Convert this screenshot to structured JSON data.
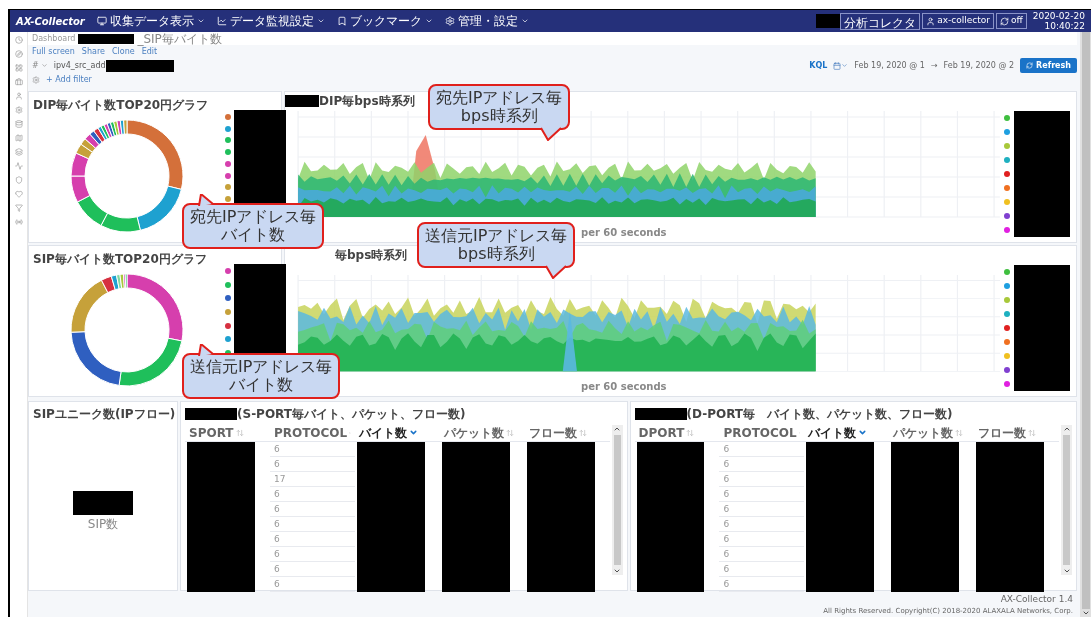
{
  "nav": {
    "brand": "AX-Collector",
    "menus": [
      {
        "label": "収集データ表示"
      },
      {
        "label": "データ監視設定"
      },
      {
        "label": "ブックマーク"
      },
      {
        "label": "管理・設定"
      }
    ],
    "collector": "分析コレクタ",
    "user": "ax-collector",
    "refresh": "off",
    "date": "2020-02-20",
    "time": "10:40:22"
  },
  "breadcrumb": {
    "root": "Dashboard",
    "suffix": "_SIP毎バイト数"
  },
  "actions": [
    "Full screen",
    "Share",
    "Clone",
    "Edit"
  ],
  "query": {
    "type": "#",
    "value": "ipv4_src_add",
    "language": "KQL",
    "start": "Feb 19, 2020 @ 1",
    "arrow": "→",
    "end": "Feb 19, 2020 @ 2",
    "refresh": "Refresh"
  },
  "add_filter": "+ Add filter",
  "rows": [
    {
      "pie": {
        "title": "DIP毎バイト数TOP20円グラフ",
        "legend": [
          {
            "color": "#d4703a"
          },
          {
            "color": "#1ea1d0"
          },
          {
            "color": "#1fbf5b"
          },
          {
            "color": "#1fbf5b"
          },
          {
            "color": "#d63fad"
          },
          {
            "color": "#d63fad"
          },
          {
            "color": "#c6a13a"
          },
          {
            "color": "#c6a13a"
          }
        ]
      },
      "series": {
        "title": "DIP毎bps時系列",
        "xlabel": "per 60 seconds",
        "legend": [
          {
            "color": "#3fbf3f"
          },
          {
            "color": "#1e9fe0"
          },
          {
            "color": "#a8c83a"
          },
          {
            "color": "#1eb0c0"
          },
          {
            "color": "#e02020"
          },
          {
            "color": "#f07020"
          },
          {
            "color": "#f0c020"
          },
          {
            "color": "#8040d0"
          },
          {
            "color": "#e020e0"
          }
        ]
      }
    },
    {
      "pie": {
        "title": "SIP毎バイト数TOP20円グラフ",
        "legend": [
          {
            "color": "#d63fad"
          },
          {
            "color": "#1fbf5b"
          },
          {
            "color": "#2f5fc0"
          },
          {
            "color": "#c6a13a"
          },
          {
            "color": "#d63040"
          },
          {
            "color": "#1ea1d0"
          },
          {
            "color": "#1fbf5b"
          }
        ]
      },
      "series": {
        "title": "毎bps時系列",
        "xlabel": "per 60 seconds",
        "legend": [
          {
            "color": "#3fbf3f"
          },
          {
            "color": "#1e9fe0"
          },
          {
            "color": "#a8c83a"
          },
          {
            "color": "#1eb0c0"
          },
          {
            "color": "#e02020"
          },
          {
            "color": "#f07020"
          },
          {
            "color": "#f0c020"
          },
          {
            "color": "#8040d0"
          },
          {
            "color": "#e020e0"
          }
        ]
      }
    }
  ],
  "metric": {
    "title": "SIPユニーク数(IPフロー)",
    "label": "SIP数"
  },
  "tables": [
    {
      "title": "(S-PORT毎バイト、パケット、フロー数)",
      "columns": [
        {
          "label": "SPORT",
          "sorted": false,
          "kind": "redacted"
        },
        {
          "label": "PROTOCOL",
          "sorted": false,
          "kind": "values"
        },
        {
          "label": "バイト数",
          "sorted": true,
          "kind": "redacted"
        },
        {
          "label": "パケット数",
          "sorted": false,
          "kind": "redacted"
        },
        {
          "label": "フロー数",
          "sorted": false,
          "kind": "redacted"
        }
      ],
      "values": [
        "6",
        "6",
        "17",
        "6",
        "6",
        "6",
        "6",
        "6",
        "6",
        "6"
      ]
    },
    {
      "title": "(D-PORT毎　バイト数、パケット数、フロー数)",
      "columns": [
        {
          "label": "DPORT",
          "sorted": false,
          "kind": "redacted"
        },
        {
          "label": "PROTOCOL",
          "sorted": false,
          "kind": "values"
        },
        {
          "label": "バイト数",
          "sorted": true,
          "kind": "redacted"
        },
        {
          "label": "パケット数",
          "sorted": false,
          "kind": "redacted"
        },
        {
          "label": "フロー数",
          "sorted": false,
          "kind": "redacted"
        }
      ],
      "values": [
        "6",
        "6",
        "6",
        "6",
        "6",
        "6",
        "6",
        "6",
        "6",
        "6"
      ]
    }
  ],
  "callouts": [
    {
      "lines": [
        "宛先IPアドレス毎",
        "bps時系列"
      ]
    },
    {
      "lines": [
        "送信元IPアドレス毎",
        "bps時系列"
      ]
    },
    {
      "lines": [
        "宛先IPアドレス毎",
        "バイト数"
      ]
    },
    {
      "lines": [
        "送信元IPアドレス毎",
        "バイト数"
      ]
    }
  ],
  "footer": {
    "version": "AX-Collector 1.4",
    "copyright": "All Rights Reserved. Copyright(C) 2018-2020 ALAXALA Networks, Corp."
  }
}
